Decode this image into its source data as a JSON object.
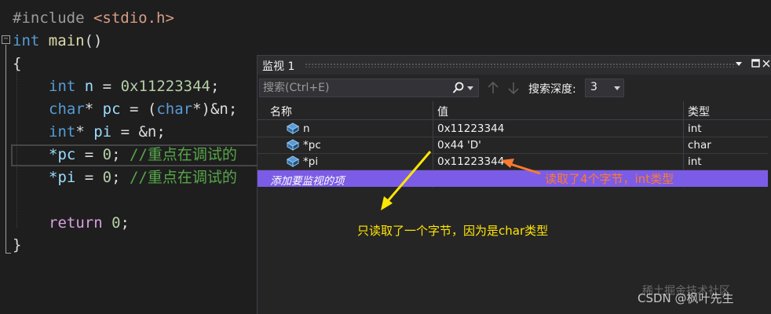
{
  "editor": {
    "include_directive": "#include",
    "include_file": "<stdio.h>",
    "main_type": "int",
    "main_name": "main",
    "main_parens": "()",
    "open_brace": "{",
    "close_brace": "}",
    "lines": [
      {
        "type": "int",
        "name": "n",
        "rest": " = ",
        "value": "0x11223344",
        "end": ";"
      },
      {
        "type": "char",
        "ptr": "*",
        "name": "pc",
        "rest": " = (",
        "cast": "char",
        "cast_end": "*)&n;"
      },
      {
        "type": "int",
        "ptr": "*",
        "name": "pi",
        "rest": " = &n;"
      },
      {
        "name": "*pc",
        "rest": " = ",
        "value": "0",
        "end": "; ",
        "comment": "//重点在调试的"
      },
      {
        "name": "*pi",
        "rest": " = ",
        "value": "0",
        "end": "; ",
        "comment": "//重点在调试的"
      }
    ],
    "return_kw": "return",
    "return_value": "0",
    "return_end": ";"
  },
  "watch": {
    "title": "监视 1",
    "search_placeholder": "搜索(Ctrl+E)",
    "depth_label": "搜索深度:",
    "depth_value": "3",
    "columns": {
      "name": "名称",
      "value": "值",
      "type": "类型"
    },
    "rows": [
      {
        "name": "n",
        "value": "0x11223344",
        "type": "int"
      },
      {
        "name": "*pc",
        "value": "0x44 'D'",
        "type": "char"
      },
      {
        "name": "*pi",
        "value": "0x11223344",
        "type": "int"
      }
    ],
    "add_item_label": "添加要监视的项"
  },
  "annotations": {
    "orange_text": "读取了4个字节，int类型",
    "yellow_text": "只读取了一个字节，因为是char类型",
    "orange_color": "#ff7a2e",
    "yellow_color": "#ffe600"
  },
  "watermark": {
    "main": "CSDN @枫叶先生",
    "faint": "稀土掘金技术社区"
  },
  "colors": {
    "editor_bg": "#1e1e1e",
    "keyword": "#569cd6",
    "comment": "#57a64a",
    "add_row_highlight": "#7b5ce6"
  }
}
